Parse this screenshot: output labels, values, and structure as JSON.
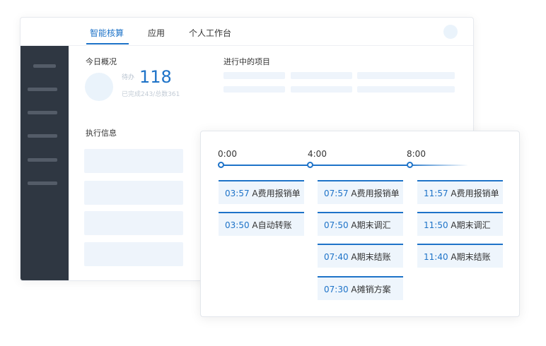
{
  "nav": {
    "tabs": [
      {
        "label": "智能核算",
        "active": true
      },
      {
        "label": "应用",
        "active": false
      },
      {
        "label": "个人工作台",
        "active": false
      }
    ]
  },
  "overview": {
    "title": "今日概况",
    "todo_label": "待办",
    "todo_count": "118",
    "summary": "已完成243/总数361"
  },
  "projects": {
    "title": "进行中的项目"
  },
  "execution": {
    "title": "执行信息"
  },
  "timeline": {
    "labels": [
      "0:00",
      "4:00",
      "8:00"
    ],
    "columns": [
      [
        {
          "time": "03:57",
          "task": "A费用报销单"
        },
        {
          "time": "03:50",
          "task": "A自动转账"
        }
      ],
      [
        {
          "time": "07:57",
          "task": "A费用报销单"
        },
        {
          "time": "07:50",
          "task": "A期末调汇"
        },
        {
          "time": "07:40",
          "task": "A期末结账"
        },
        {
          "time": "07:30",
          "task": "A摊销方案"
        }
      ],
      [
        {
          "time": "11:57",
          "task": "A费用报销单"
        },
        {
          "time": "11:50",
          "task": "A期末调汇"
        },
        {
          "time": "11:40",
          "task": "A期末结账"
        }
      ]
    ]
  },
  "colors": {
    "accent": "#1e73c8",
    "sidebar": "#2f3742",
    "card_bg": "#eef5fc"
  }
}
